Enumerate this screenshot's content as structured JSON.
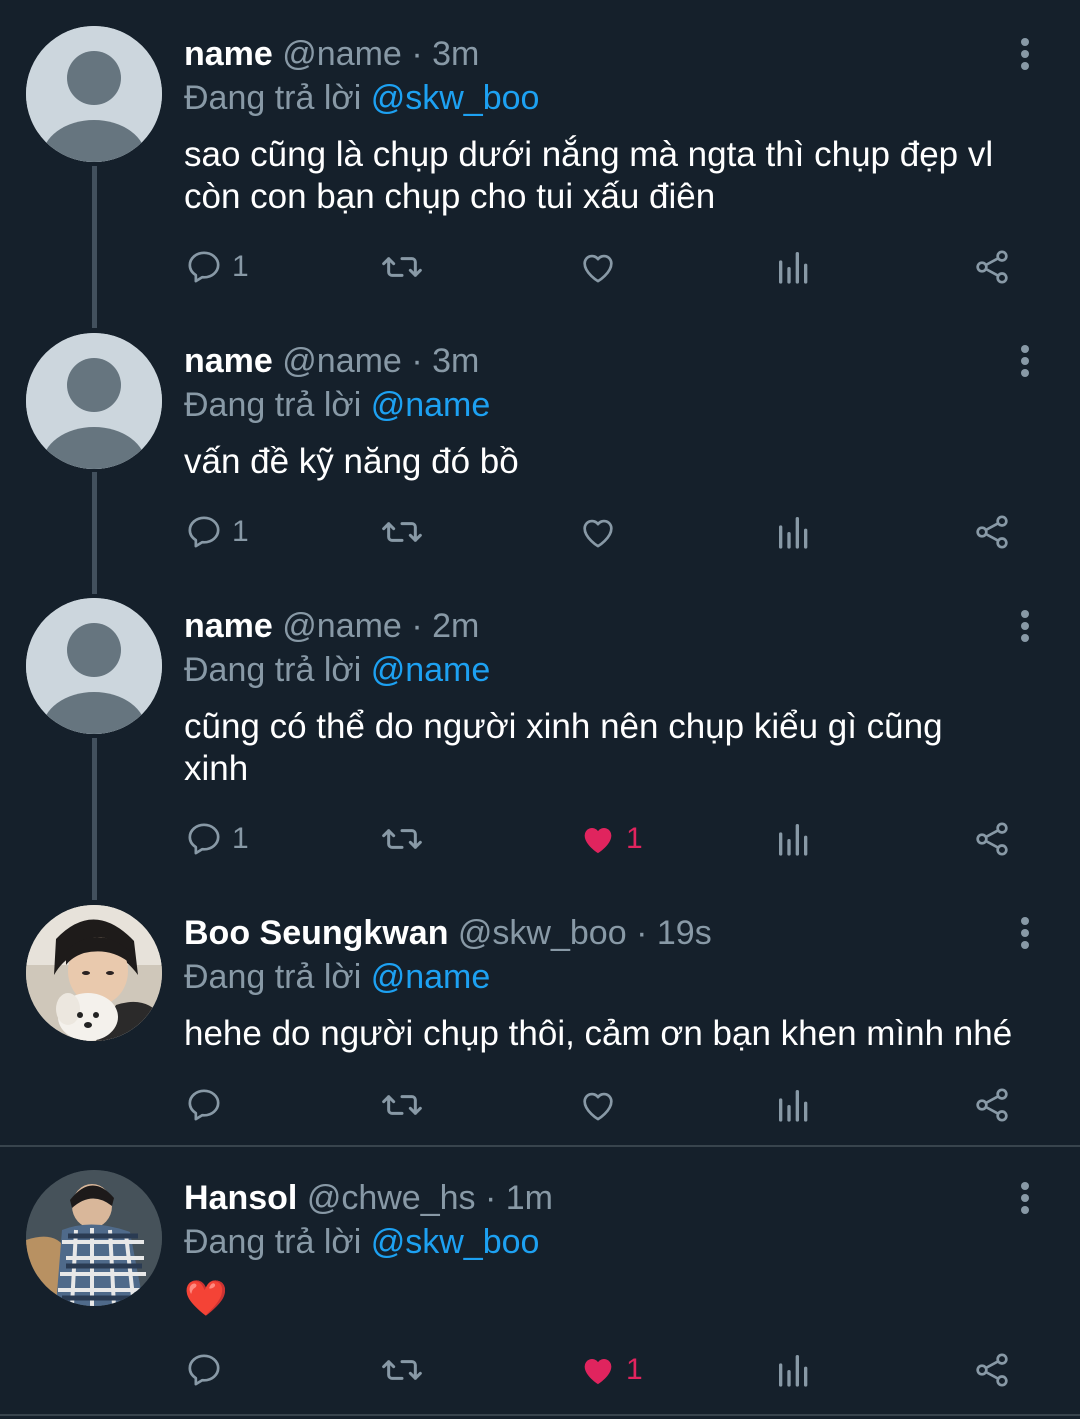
{
  "replying_prefix": "Đang trả lời",
  "dot": "·",
  "tweets": [
    {
      "name": "name",
      "handle": "@name",
      "time": "3m",
      "replying_to": "@skw_boo",
      "text_lines": [
        "sao cũng là chụp dưới nắng mà ngta thì chụp đẹp vl",
        "còn con bạn chụp cho tui xấu điên"
      ],
      "reply_count": "1",
      "like_count": "",
      "liked": false,
      "avatar": "default-avatar"
    },
    {
      "name": "name",
      "handle": "@name",
      "time": "3m",
      "replying_to": "@name",
      "text_lines": [
        "vấn đề kỹ năng đó bồ"
      ],
      "reply_count": "1",
      "like_count": "",
      "liked": false,
      "avatar": "default-avatar"
    },
    {
      "name": "name",
      "handle": "@name",
      "time": "2m",
      "replying_to": "@name",
      "text_lines": [
        "cũng có thể do người xinh nên chụp kiểu gì cũng",
        "xinh"
      ],
      "reply_count": "1",
      "like_count": "1",
      "liked": true,
      "avatar": "default-avatar"
    },
    {
      "name": "Boo Seungkwan",
      "handle": "@skw_boo",
      "time": "19s",
      "replying_to": "@name",
      "text_lines": [
        "hehe do người chụp thôi, cảm ơn bạn khen mình nhé"
      ],
      "reply_count": "",
      "like_count": "",
      "liked": false,
      "avatar": "photo-avatar-with-dog"
    },
    {
      "name": "Hansol",
      "handle": "@chwe_hs",
      "time": "1m",
      "replying_to": "@skw_boo",
      "text_lines": [
        "❤️"
      ],
      "reply_count": "",
      "like_count": "1",
      "liked": true,
      "avatar": "photo-avatar-plaid"
    }
  ],
  "colors": {
    "background": "#15202b",
    "secondary_text": "#8899a6",
    "mention": "#1da1f2",
    "like": "#e0245e",
    "thread_line": "#42505d"
  }
}
